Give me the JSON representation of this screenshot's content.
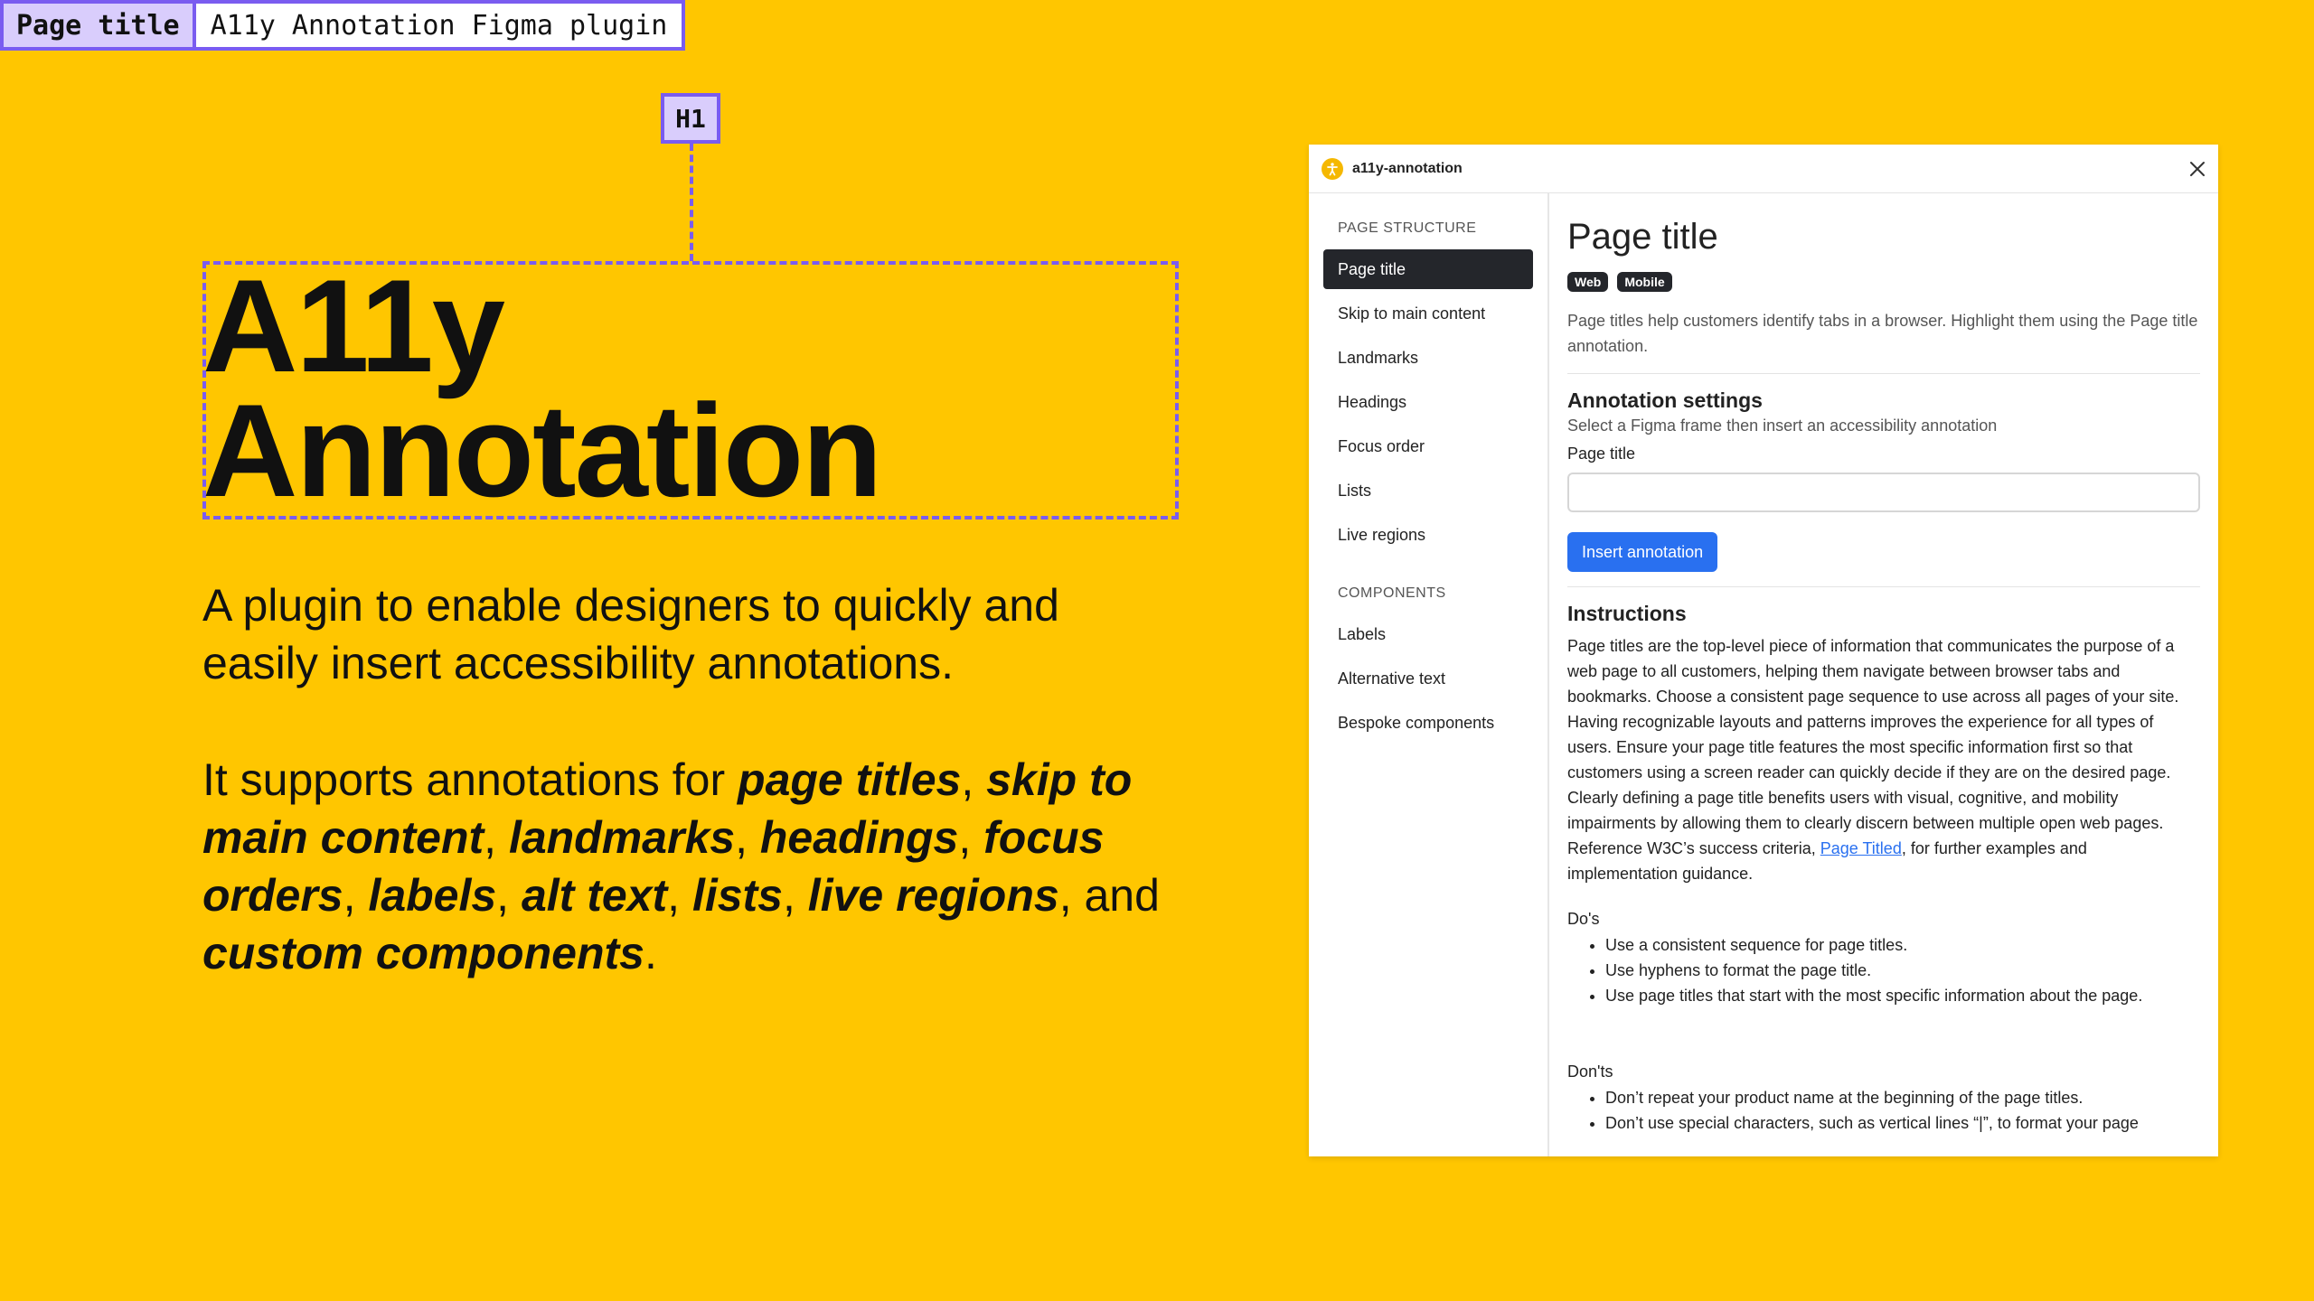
{
  "title_tag": {
    "key": "Page title",
    "value": "A11y Annotation Figma plugin"
  },
  "h1_badge": "H1",
  "hero": {
    "title_line1": "A11y",
    "title_line2": "Annotation",
    "description": "A plugin to enable designers to quickly and easily insert accessibility annotations.",
    "support_prefix": "It supports annotations for ",
    "support_items": [
      "page titles",
      "skip to main content",
      "landmarks",
      "headings",
      "focus orders",
      "labels",
      "alt text",
      "lists",
      "live regions"
    ],
    "support_and": "and",
    "support_last": "custom components",
    "support_suffix": "."
  },
  "plugin": {
    "name": "a11y-annotation",
    "logo_icon": "accessibility-icon",
    "close_icon": "close-icon",
    "sidebar": {
      "section1": "PAGE STRUCTURE",
      "items1": [
        "Page title",
        "Skip to main content",
        "Landmarks",
        "Headings",
        "Focus order",
        "Lists",
        "Live regions"
      ],
      "section2": "COMPONENTS",
      "items2": [
        "Labels",
        "Alternative text",
        "Bespoke components"
      ],
      "active": "Page title"
    },
    "main": {
      "title": "Page title",
      "badges": [
        "Web",
        "Mobile"
      ],
      "description": "Page titles help customers identify tabs in a browser. Highlight them using the Page title annotation.",
      "settings_heading": "Annotation settings",
      "settings_sub": "Select a Figma frame then insert an accessibility annotation",
      "field_label": "Page title",
      "field_value": "",
      "field_placeholder": "",
      "insert_button": "Insert annotation",
      "instructions_heading": "Instructions",
      "instructions_before_link": "Page titles are the top-level piece of information that communicates the purpose of a web page to all customers, helping them navigate between browser tabs and bookmarks. Choose a consistent page sequence to use across all pages of your site. Having recognizable layouts and patterns improves the experience for all types of users. Ensure your page title features the most specific information first so that customers using a screen reader can quickly decide if they are on the desired page. Clearly defining a page title benefits users with visual, cognitive, and mobility impairments by allowing them to clearly discern between multiple open web pages. Reference W3C’s success criteria, ",
      "instructions_link": "Page Titled",
      "instructions_after_link": ", for further examples and implementation guidance.",
      "dos_heading": "Do's",
      "dos": [
        "Use a consistent sequence for page titles.",
        "Use hyphens to format the page title.",
        "Use page titles that start with the most specific information about the page."
      ],
      "donts_heading": "Don'ts",
      "donts": [
        "Don’t repeat your product name at the beginning of the page titles.",
        "Don’t use special characters, such as vertical lines “|”, to format your page"
      ]
    }
  }
}
